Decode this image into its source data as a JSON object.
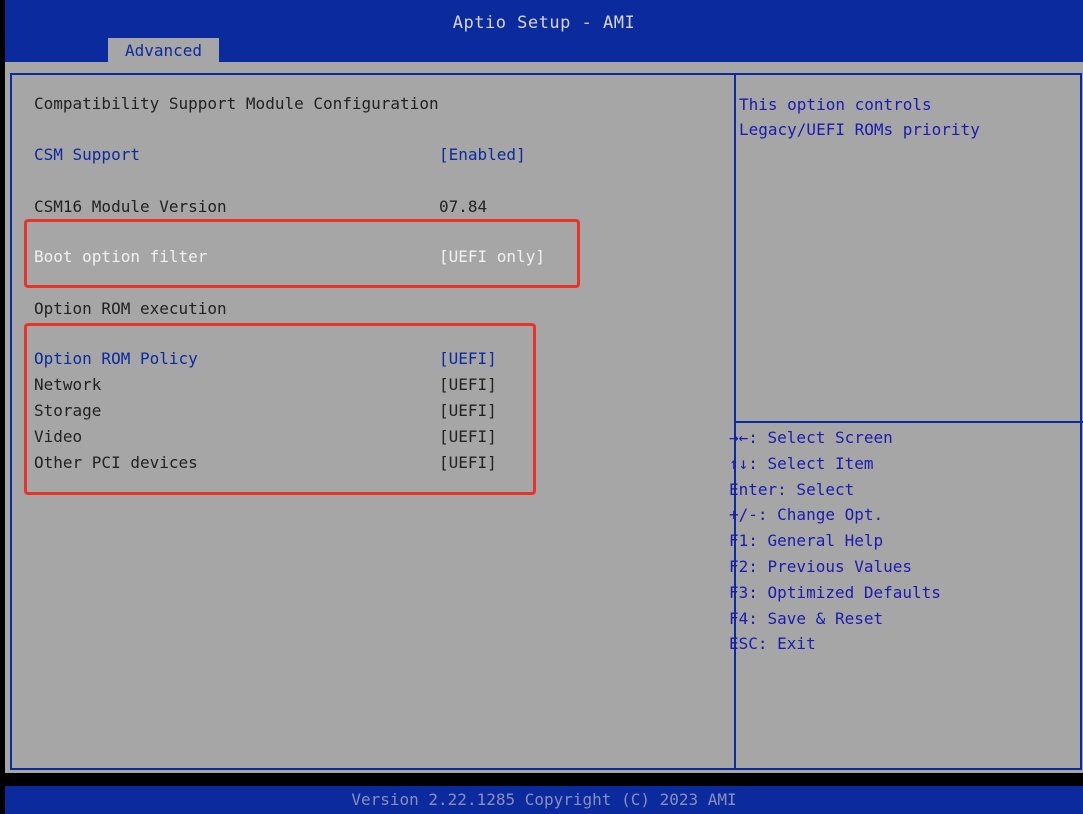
{
  "header": {
    "title": "Aptio Setup - AMI",
    "tab": "Advanced"
  },
  "section_title": "Compatibility Support Module Configuration",
  "settings": {
    "csm_support": {
      "label": "CSM Support",
      "value": "[Enabled]"
    },
    "csm16_version": {
      "label": "CSM16 Module Version",
      "value": "07.84"
    },
    "boot_option_filter": {
      "label": "Boot option filter",
      "value": "[UEFI only]"
    },
    "option_rom_execution": {
      "label": "Option ROM execution"
    },
    "option_rom_policy": {
      "label": "Option ROM Policy",
      "value": "[UEFI]"
    },
    "network": {
      "label": "Network",
      "value": "[UEFI]"
    },
    "storage": {
      "label": "Storage",
      "value": "[UEFI]"
    },
    "video": {
      "label": "Video",
      "value": "[UEFI]"
    },
    "other_pci": {
      "label": "Other PCI devices",
      "value": "[UEFI]"
    }
  },
  "help_text": "This option controls\nLegacy/UEFI ROMs priority",
  "key_help": [
    "→←: Select Screen",
    "↑↓: Select Item",
    "Enter: Select",
    "+/-: Change Opt.",
    "F1: General Help",
    "F2: Previous Values",
    "F3: Optimized Defaults",
    "F4: Save & Reset",
    "ESC: Exit"
  ],
  "footer": {
    "version": "Version 2.22.1285 Copyright (C) 2023 AMI"
  },
  "colors": {
    "header_blue": "#0b2a9e",
    "panel_grey": "#a6a6a6",
    "annotation_red": "#e8332a",
    "help_blue": "#1b1bb0"
  }
}
